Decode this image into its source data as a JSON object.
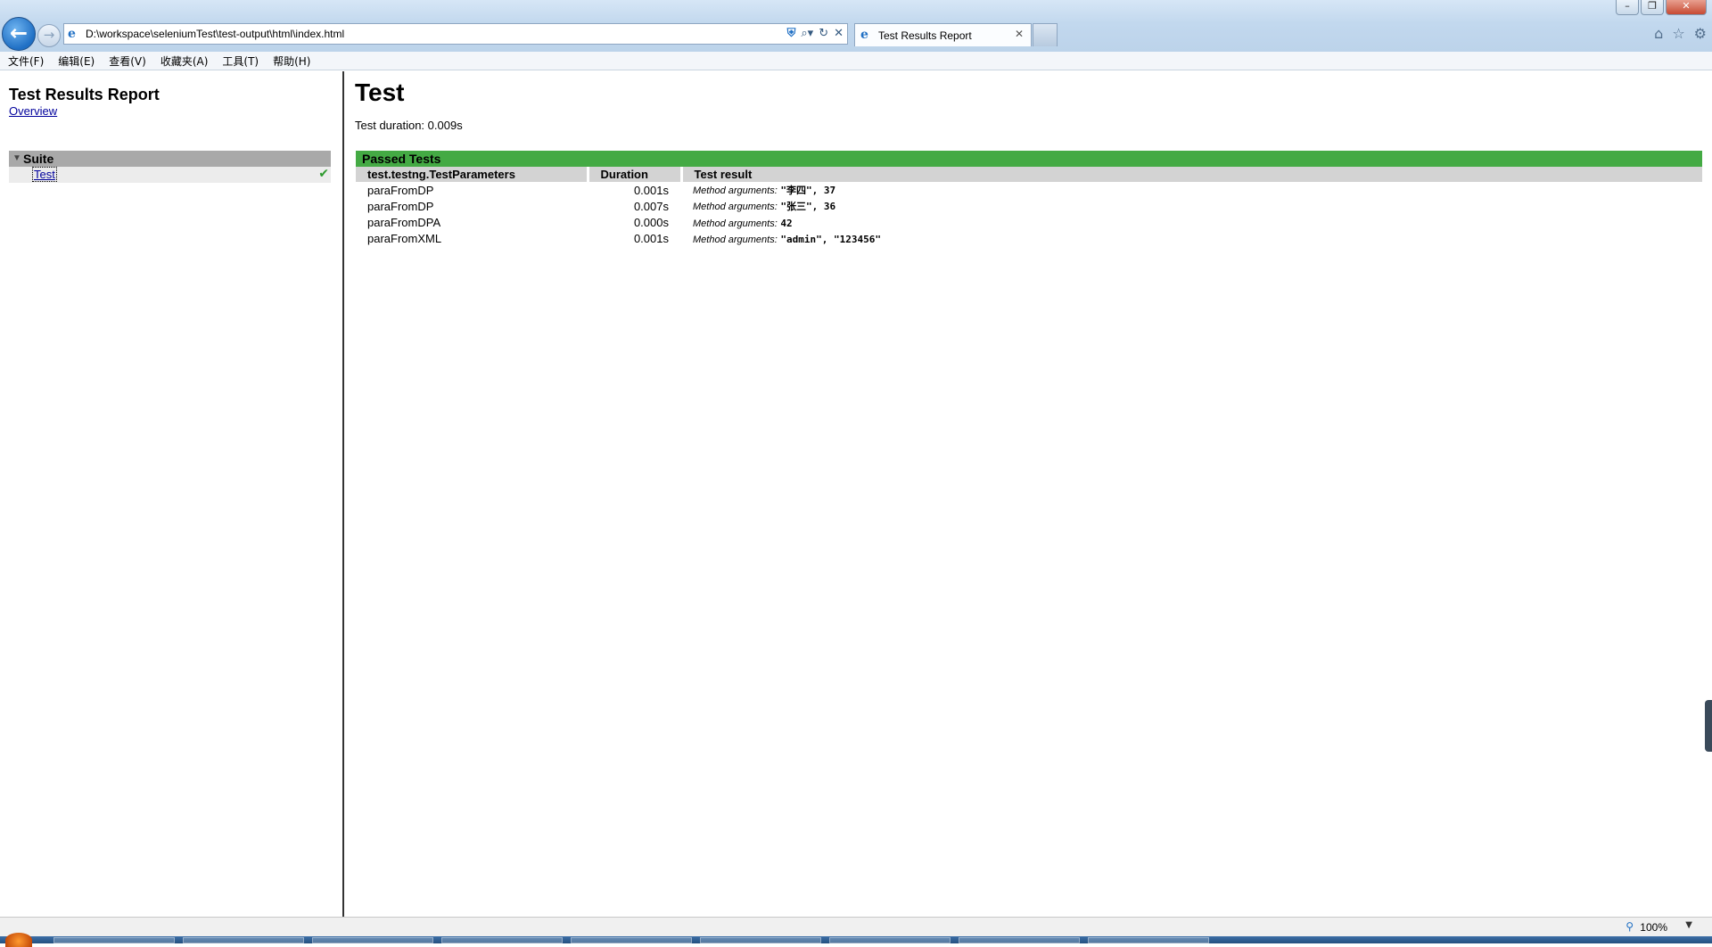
{
  "browser": {
    "address": "D:\\workspace\\seleniumTest\\test-output\\html\\index.html",
    "tab_title": "Test Results Report",
    "zoom": "100%"
  },
  "menu": [
    "文件(F)",
    "编辑(E)",
    "查看(V)",
    "收藏夹(A)",
    "工具(T)",
    "帮助(H)"
  ],
  "sidebar": {
    "title": "Test Results Report",
    "overview_link": "Overview",
    "suite_name": "Suite",
    "test_link": "Test"
  },
  "main": {
    "title": "Test",
    "duration_label": "Test duration: 0.009s",
    "passed_header": "Passed Tests",
    "columns": [
      "test.testng.TestParameters",
      "Duration",
      "Test result"
    ],
    "args_label": "Method arguments:",
    "rows": [
      {
        "method": "paraFromDP",
        "duration": "0.001s",
        "args": "\"李四\", 37"
      },
      {
        "method": "paraFromDP",
        "duration": "0.007s",
        "args": "\"张三\", 36"
      },
      {
        "method": "paraFromDPA",
        "duration": "0.000s",
        "args": "42"
      },
      {
        "method": "paraFromXML",
        "duration": "0.001s",
        "args": "\"admin\", \"123456\""
      }
    ]
  },
  "colors": {
    "passed_green": "#44aa44",
    "suite_gray": "#a9a9a9",
    "header_gray": "#d3d3d3",
    "link_blue": "#00009c"
  },
  "icons": [
    "back-arrow-icon",
    "forward-arrow-icon",
    "ie-page-icon",
    "shield-icon",
    "search-icon",
    "refresh-icon",
    "stop-icon",
    "home-icon",
    "favorites-star-icon",
    "gear-icon",
    "check-icon",
    "zoom-icon"
  ]
}
